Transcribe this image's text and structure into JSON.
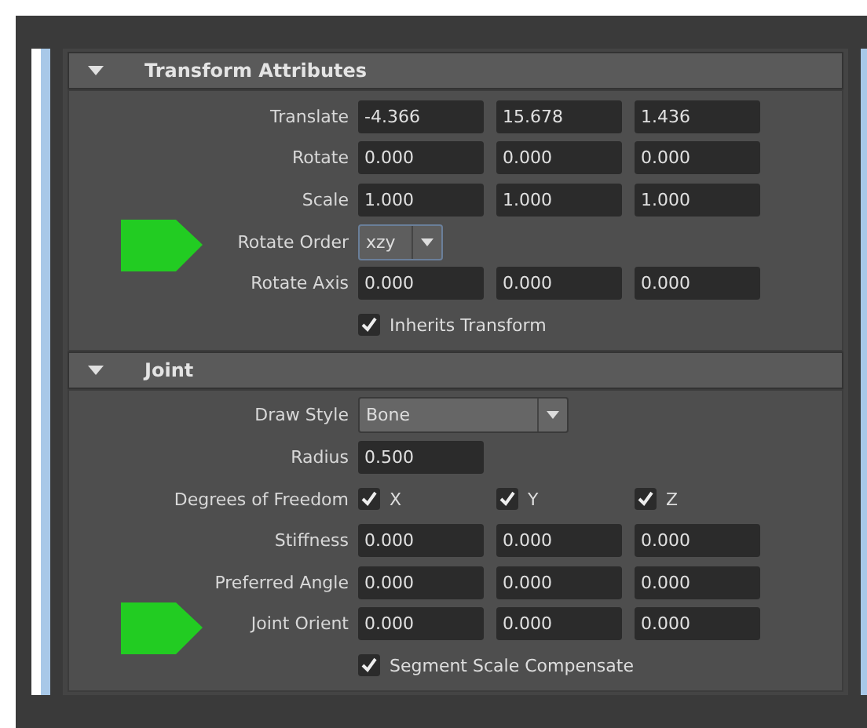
{
  "sections": [
    {
      "title": "Transform Attributes",
      "expanded": true,
      "rows": [
        {
          "kind": "vector",
          "label": "Translate",
          "highlighted": false,
          "values": [
            "-4.366",
            "15.678",
            "1.436"
          ]
        },
        {
          "kind": "vector",
          "label": "Rotate",
          "highlighted": false,
          "values": [
            "0.000",
            "0.000",
            "0.000"
          ]
        },
        {
          "kind": "vector",
          "label": "Scale",
          "highlighted": false,
          "values": [
            "1.000",
            "1.000",
            "1.000"
          ]
        },
        {
          "kind": "dropdown",
          "label": "Rotate Order",
          "highlighted": true,
          "value": "xzy"
        },
        {
          "kind": "vector",
          "label": "Rotate Axis",
          "highlighted": false,
          "values": [
            "0.000",
            "0.000",
            "0.000"
          ]
        },
        {
          "kind": "checkbox",
          "label": "",
          "highlighted": false,
          "text": "Inherits Transform",
          "checked": true
        }
      ]
    },
    {
      "title": "Joint",
      "expanded": true,
      "rows": [
        {
          "kind": "dropdown",
          "label": "Draw Style",
          "highlighted": false,
          "value": "Bone"
        },
        {
          "kind": "vector",
          "label": "Radius",
          "highlighted": false,
          "values": [
            "0.500"
          ]
        },
        {
          "kind": "checkboxes",
          "label": "Degrees of Freedom",
          "highlighted": false,
          "options": [
            {
              "text": "X",
              "checked": true
            },
            {
              "text": "Y",
              "checked": true
            },
            {
              "text": "Z",
              "checked": true
            }
          ]
        },
        {
          "kind": "vector",
          "label": "Stiffness",
          "highlighted": false,
          "values": [
            "0.000",
            "0.000",
            "0.000"
          ]
        },
        {
          "kind": "vector",
          "label": "Preferred Angle",
          "highlighted": false,
          "values": [
            "0.000",
            "0.000",
            "0.000"
          ]
        },
        {
          "kind": "vector",
          "label": "Joint Orient",
          "highlighted": true,
          "values": [
            "0.000",
            "0.000",
            "0.000"
          ]
        },
        {
          "kind": "checkbox",
          "label": "",
          "highlighted": false,
          "text": "Segment Scale Compensate",
          "checked": true
        }
      ]
    }
  ]
}
